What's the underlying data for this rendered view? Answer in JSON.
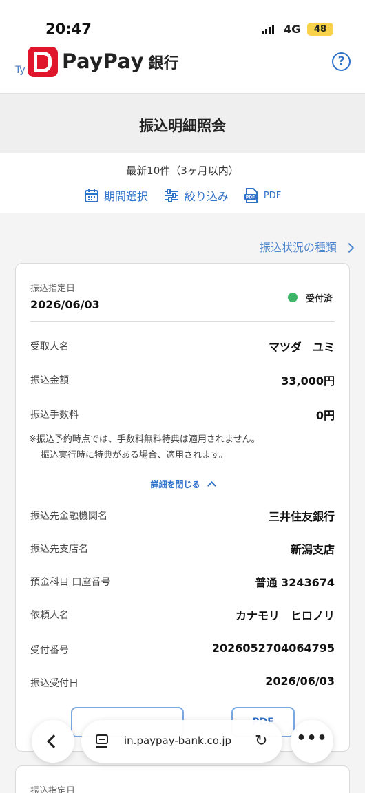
{
  "status_bar": {
    "time": "20:47",
    "network": "4G",
    "battery": "48"
  },
  "header": {
    "prefix": "Ty",
    "brand": "PayPay",
    "bank": "銀行",
    "help_icon": "?"
  },
  "page": {
    "title": "振込明細照会"
  },
  "filter": {
    "count_text": "最新10件（3ヶ月以内）",
    "period_label": "期間選択",
    "narrow_label": "絞り込み",
    "pdf_label": "PDF"
  },
  "kinds_link": "振込状況の種類",
  "card": {
    "date_label": "振込指定日",
    "date": "2026/06/03",
    "status": "受付済",
    "status_color": "#3fb56a",
    "rows_top": [
      {
        "label": "受取人名",
        "value": "マツダ　ユミ"
      },
      {
        "label": "振込金額",
        "value": "33,000円"
      },
      {
        "label": "振込手数料",
        "value": "0円"
      }
    ],
    "note_line1": "※振込予約時点では、手数料無料特典は適用されません。",
    "note_line2": "振込実行時に特典がある場合、適用されます。",
    "close_details": "詳細を閉じる",
    "rows_detail": [
      {
        "label": "振込先金融機関名",
        "value": "三井住友銀行"
      },
      {
        "label": "振込先支店名",
        "value": "新潟支店"
      },
      {
        "label": "預金科目 口座番号",
        "value": "普通 3243674"
      },
      {
        "label": "依頼人名",
        "value": "カナモリ　ヒロノリ"
      },
      {
        "label": "受付番号",
        "value": "2026052704064795"
      },
      {
        "label": "振込受付日",
        "value": "2026/06/03"
      }
    ],
    "pdf_button": "PDF"
  },
  "card2": {
    "date_label": "振込指定日"
  },
  "browser": {
    "url": "in.paypay-bank.co.jp",
    "reload_icon": "↻",
    "more_icon": "•••"
  },
  "colors": {
    "accent": "#2f73c9",
    "brand_red": "#e0172c"
  }
}
